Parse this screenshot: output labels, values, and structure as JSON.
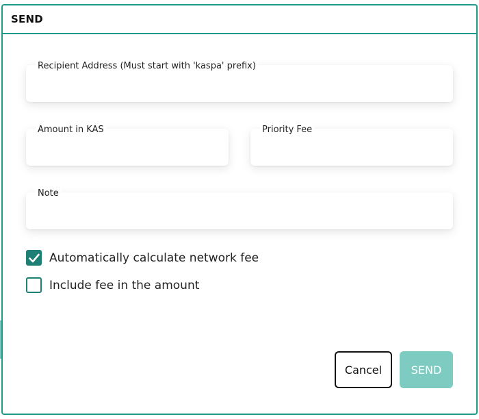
{
  "dialog": {
    "title": "SEND"
  },
  "fields": {
    "recipient": {
      "label": "Recipient Address (Must start with 'kaspa' prefix)",
      "value": ""
    },
    "amount": {
      "label": "Amount in KAS",
      "value": ""
    },
    "priority_fee": {
      "label": "Priority Fee",
      "value": ""
    },
    "note": {
      "label": "Note",
      "value": ""
    }
  },
  "options": {
    "auto_fee": {
      "label": "Automatically calculate network fee",
      "checked": true
    },
    "include_fee": {
      "label": "Include fee in the amount",
      "checked": false
    }
  },
  "buttons": {
    "cancel": "Cancel",
    "send": "SEND"
  },
  "colors": {
    "accent": "#1e9a8c",
    "checkbox": "#1e7f75",
    "send_disabled": "#7dcbc1"
  },
  "icons": {
    "checkmark": "check-icon"
  }
}
